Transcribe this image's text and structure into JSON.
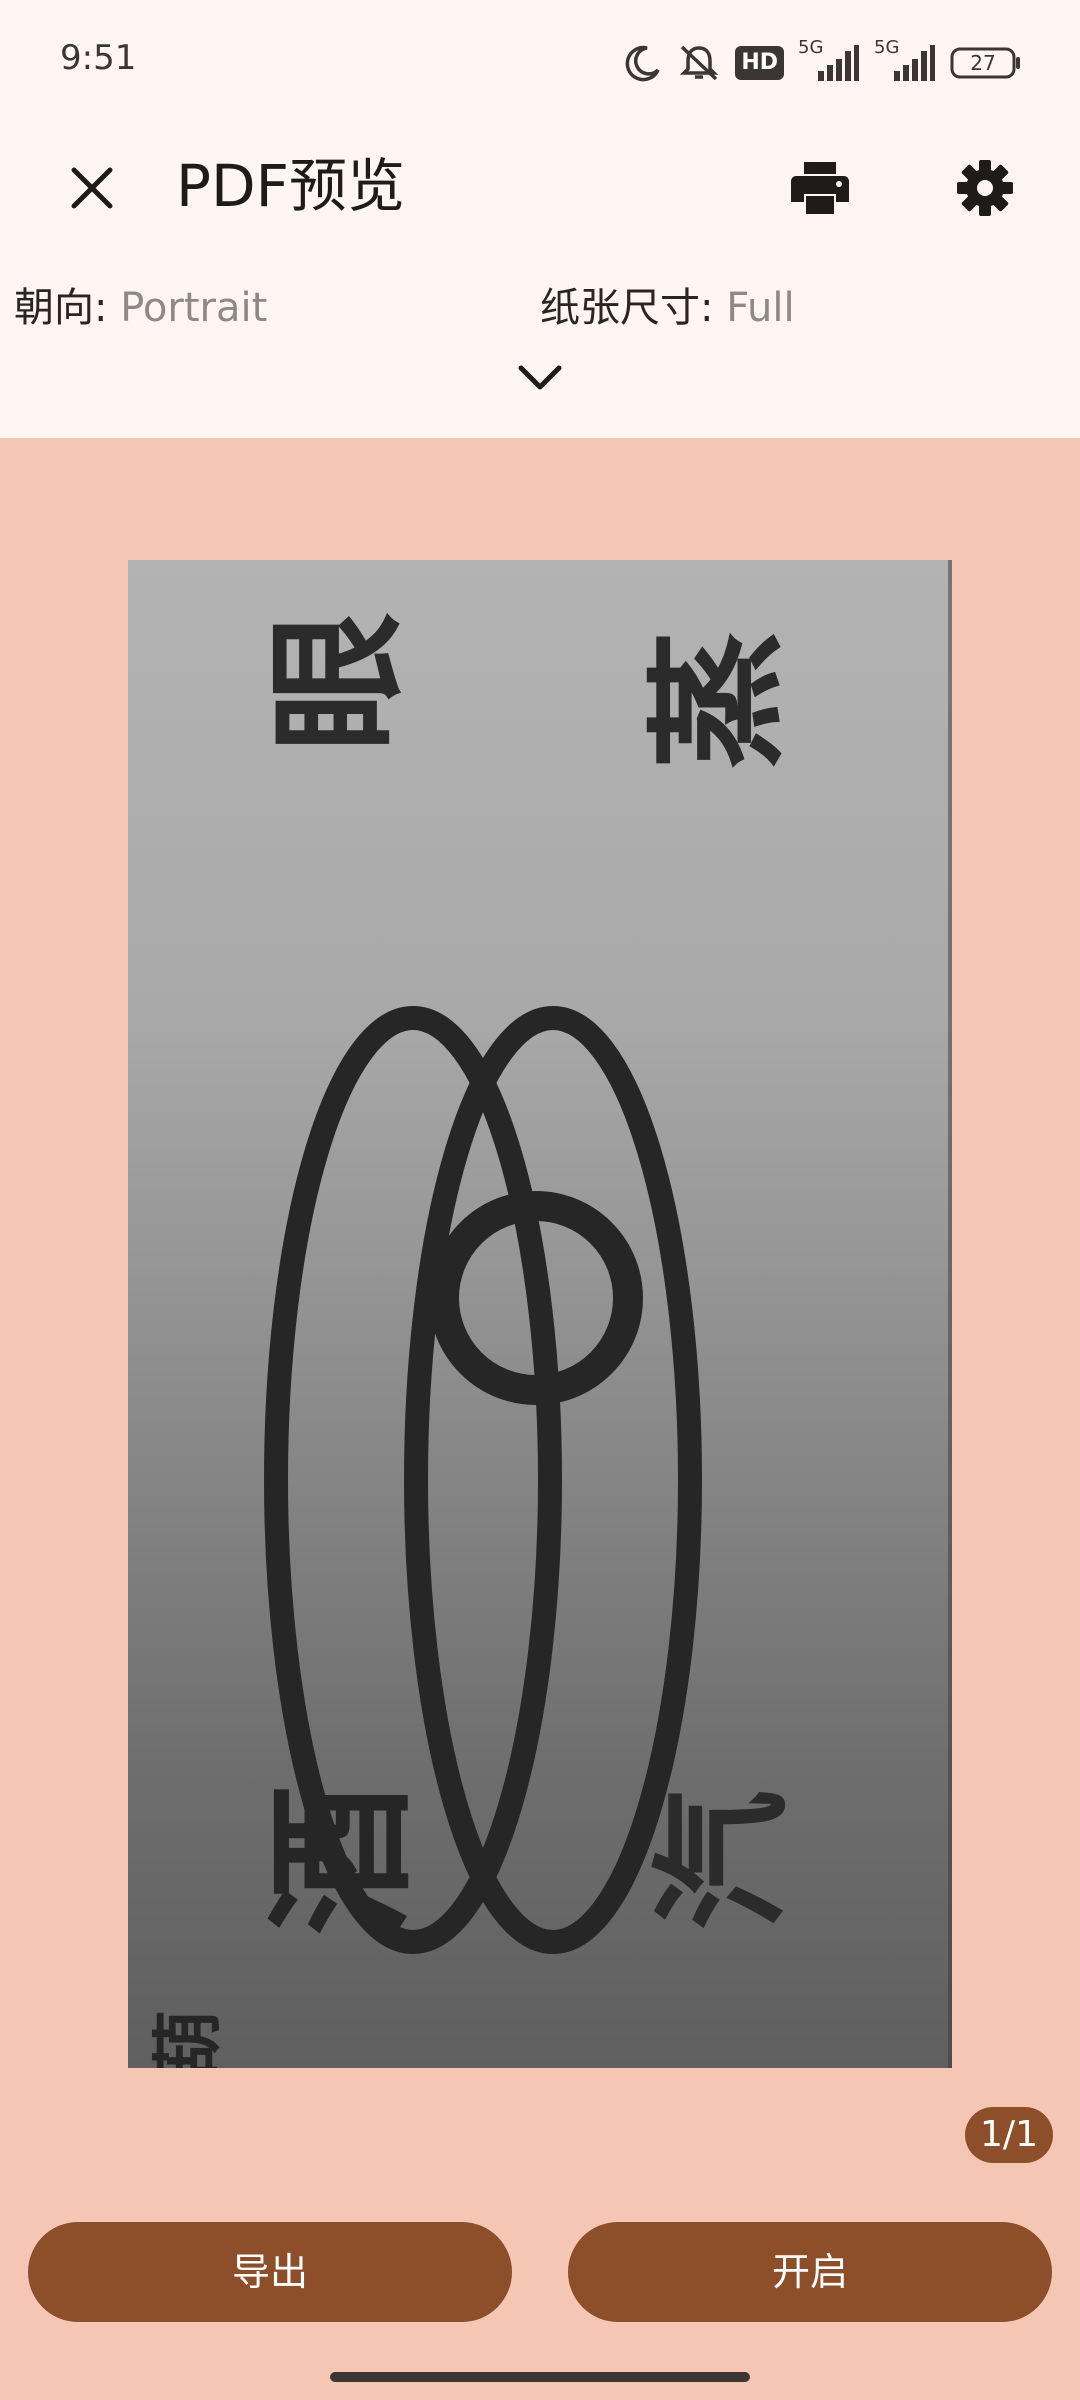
{
  "status_bar": {
    "time": "9:51",
    "icons": [
      "moon-icon",
      "bell-off-icon",
      "hd-icon",
      "signal-5g-icon",
      "signal-5g-icon",
      "battery-icon"
    ],
    "hd_label": "HD",
    "network_label_1": "5G",
    "network_label_2": "5G",
    "battery_level": "27"
  },
  "app_bar": {
    "title": "PDF预览",
    "close_icon": "close-icon",
    "print_icon": "print-icon",
    "settings_icon": "gear-icon"
  },
  "options": {
    "orientation_label": "朝向:",
    "orientation_value": "Portrait",
    "paper_label": "纸张尺寸:",
    "paper_value": "Full",
    "expand_icon": "chevron-down-icon"
  },
  "preview": {
    "characters": [
      "眼",
      "蒸",
      "汽",
      "酒",
      "葫"
    ],
    "page_counter": "1/1"
  },
  "actions": {
    "export_label": "导出",
    "enable_label": "开启"
  },
  "colors": {
    "accent": "#8d4f2a",
    "background": "#f6c6b5",
    "header": "#fff5f2"
  }
}
